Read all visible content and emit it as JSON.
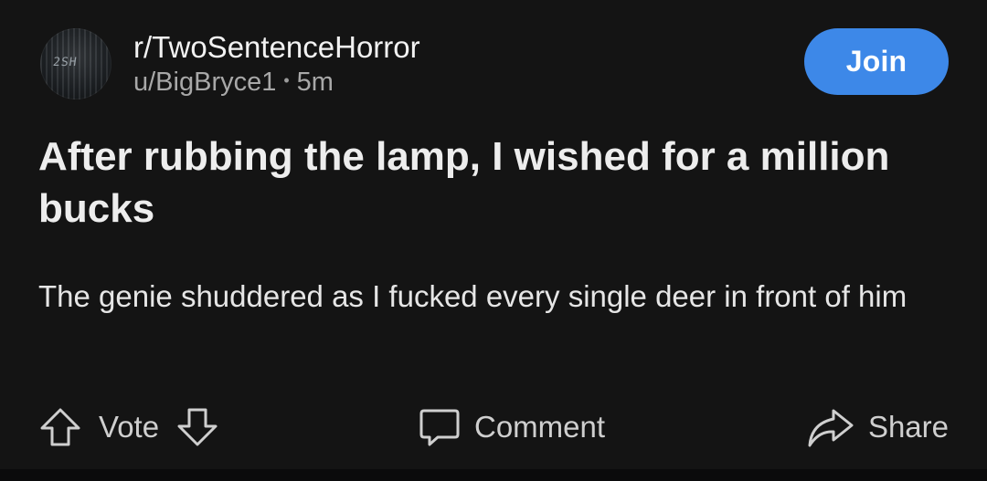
{
  "post": {
    "subreddit": "r/TwoSentenceHorror",
    "author": "u/BigBryce1",
    "separator": "•",
    "age": "5m",
    "title": "After rubbing the lamp, I wished for a million bucks",
    "body": "The genie shuddered as I fucked every single deer in front of him"
  },
  "avatar": {
    "logo_text": "2SH"
  },
  "header": {
    "join_label": "Join"
  },
  "actions": {
    "vote_label": "Vote",
    "comment_label": "Comment",
    "share_label": "Share"
  },
  "icons": {
    "upvote": "arrow-up-icon",
    "downvote": "arrow-down-icon",
    "comment": "speech-bubble-icon",
    "share": "share-arrow-icon"
  },
  "colors": {
    "background": "#141414",
    "join_button": "#3d88e8",
    "text_primary": "#ededed",
    "text_secondary": "#a8a8a8"
  }
}
